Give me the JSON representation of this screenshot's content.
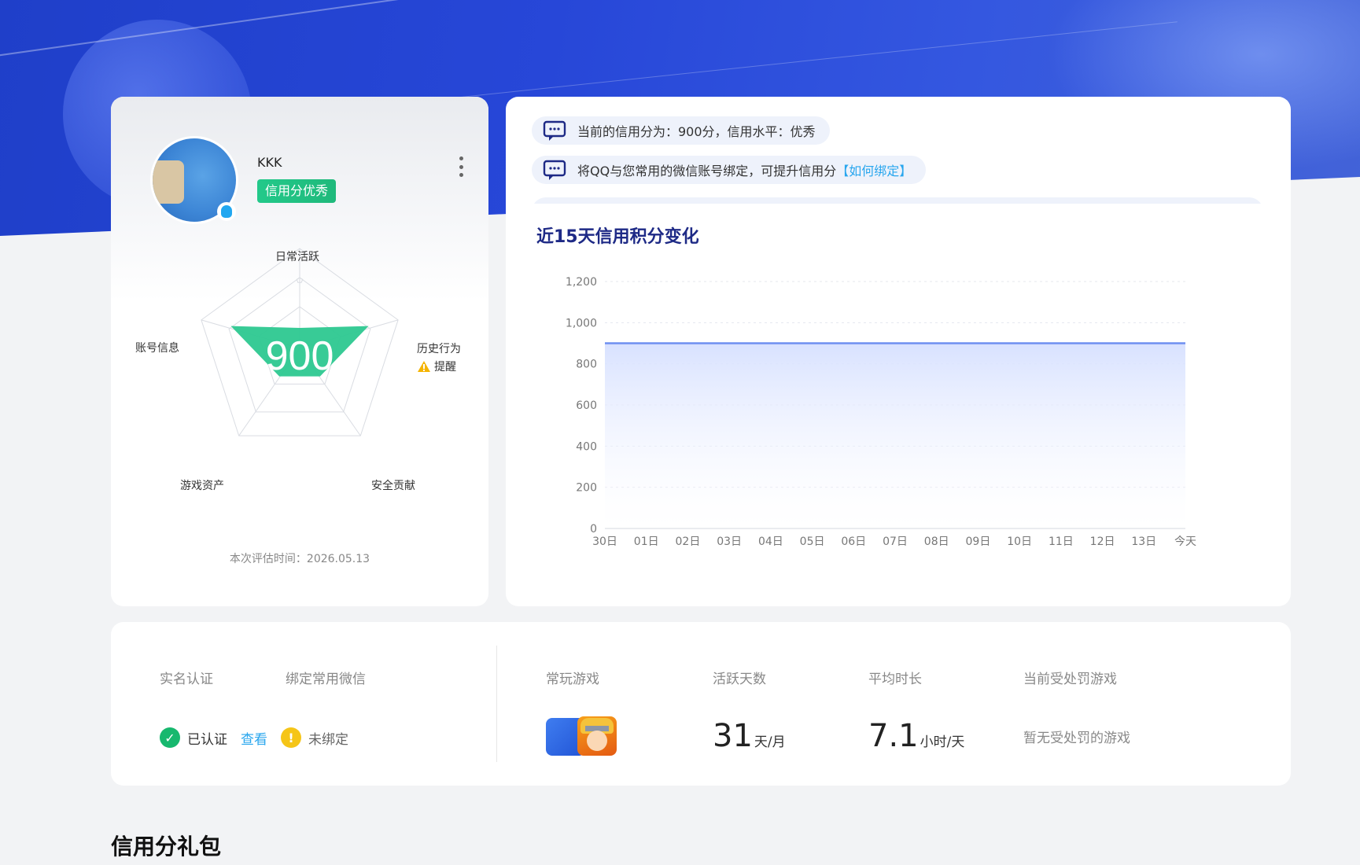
{
  "profile": {
    "username": "KKK",
    "credit_badge": "信用分优秀",
    "score": "900",
    "radar_labels": {
      "top": "日常活跃",
      "right": "历史行为",
      "bottom_right": "安全贡献",
      "bottom_left": "游戏资产",
      "left": "账号信息"
    },
    "warning_text": "提醒",
    "eval_time": "本次评估时间：2026.05.13"
  },
  "notices": [
    {
      "text": "当前的信用分为：900分，信用水平：优秀",
      "link": ""
    },
    {
      "text": "将QQ与您常用的微信账号绑定，可提升信用分",
      "link": "【如何绑定】"
    }
  ],
  "trend": {
    "title": "近15天信用积分变化"
  },
  "chart_data": {
    "type": "area",
    "title": "近15天信用积分变化",
    "categories": [
      "30日",
      "01日",
      "02日",
      "03日",
      "04日",
      "05日",
      "06日",
      "07日",
      "08日",
      "09日",
      "10日",
      "11日",
      "12日",
      "13日",
      "今天"
    ],
    "series": [
      {
        "values": [
          900,
          900,
          900,
          900,
          900,
          900,
          900,
          900,
          900,
          900,
          900,
          900,
          900,
          900,
          900
        ]
      }
    ],
    "yticks": [
      "0",
      "200",
      "400",
      "600",
      "800",
      "1,000",
      "1,200"
    ],
    "ylim": [
      0,
      1200
    ],
    "grid": true,
    "colors": {
      "line": "#6f8ff0",
      "fill": "#dbe4ff"
    }
  },
  "stats": {
    "headers": {
      "realname": "实名认证",
      "wechat": "绑定常用微信",
      "games": "常玩游戏",
      "active_days": "活跃天数",
      "avg_time": "平均时长",
      "punished": "当前受处罚游戏"
    },
    "verified": "已认证",
    "view": "查看",
    "unbound": "未绑定",
    "active_days_value": "31",
    "active_days_unit": "天/月",
    "avg_time_value": "7.1",
    "avg_time_unit": "小时/天",
    "punished_value": "暂无受处罚的游戏"
  },
  "gift_section_title": "信用分礼包",
  "colors": {
    "banner": "#2545d4",
    "accent_green": "#1fb97b",
    "link_blue": "#28a6ee",
    "title_navy": "#1e2a86"
  }
}
